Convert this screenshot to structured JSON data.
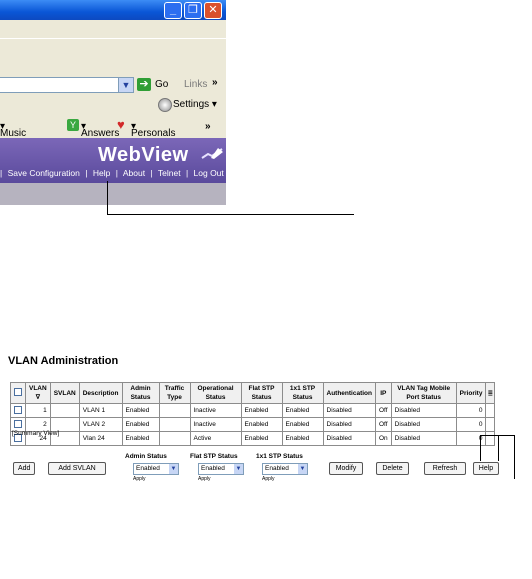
{
  "browser": {
    "window_buttons": {
      "minimize": "_",
      "maximize": "❐",
      "close": "✕"
    },
    "address_bar": {
      "go_label": "Go",
      "links_label": "Links",
      "more_glyph": "»"
    },
    "settings_label": "Settings",
    "links_bar": {
      "music_label": "Music",
      "answers_label": "Answers",
      "personals_label": "Personals",
      "more_glyph": "»"
    },
    "webview_title": "WebView",
    "nav_links": [
      "|",
      "Save Configuration",
      "|",
      "Help",
      "|",
      "About",
      "|",
      "Telnet",
      "|",
      "Log Out"
    ]
  },
  "vlan_admin": {
    "title": "VLAN Administration",
    "columns": [
      "",
      "VLAN",
      "SVLAN",
      "Description",
      "Admin Status",
      "Traffic Type",
      "Operational Status",
      "Flat STP Status",
      "1x1 STP Status",
      "Authentication",
      "IP",
      "VLAN Tag Mobile Port Status",
      "Priority"
    ],
    "rows": [
      {
        "vlan": "1",
        "svlan": "",
        "description": "VLAN 1",
        "admin_status": "Enabled",
        "traffic_type": "",
        "operational_status": "Inactive",
        "flat_stp": "Enabled",
        "stp_1x1": "Enabled",
        "authentication": "Disabled",
        "ip": "Off",
        "mobile_tag": "Disabled",
        "priority": "0"
      },
      {
        "vlan": "2",
        "svlan": "",
        "description": "VLAN 2",
        "admin_status": "Enabled",
        "traffic_type": "",
        "operational_status": "Inactive",
        "flat_stp": "Enabled",
        "stp_1x1": "Enabled",
        "authentication": "Disabled",
        "ip": "Off",
        "mobile_tag": "Disabled",
        "priority": "0"
      },
      {
        "vlan": "24",
        "svlan": "",
        "description": "Vlan 24",
        "admin_status": "Enabled",
        "traffic_type": "",
        "operational_status": "Active",
        "flat_stp": "Enabled",
        "stp_1x1": "Enabled",
        "authentication": "Disabled",
        "ip": "On",
        "mobile_tag": "Disabled",
        "priority": "0"
      }
    ],
    "summary_view": "[Summary View]",
    "buttons": {
      "add": "Add",
      "add_svlan": "Add SVLAN",
      "modify": "Modify",
      "delete": "Delete",
      "refresh": "Refresh",
      "help": "Help"
    },
    "admin_status": {
      "label": "Admin Status",
      "value": "Enabled",
      "apply": "Apply"
    },
    "flat_stp_status": {
      "label": "Flat STP Status",
      "value": "Enabled",
      "apply": "Apply"
    },
    "stp_1x1_status": {
      "label": "1x1 STP Status",
      "value": "Enabled",
      "apply": "Apply"
    }
  }
}
